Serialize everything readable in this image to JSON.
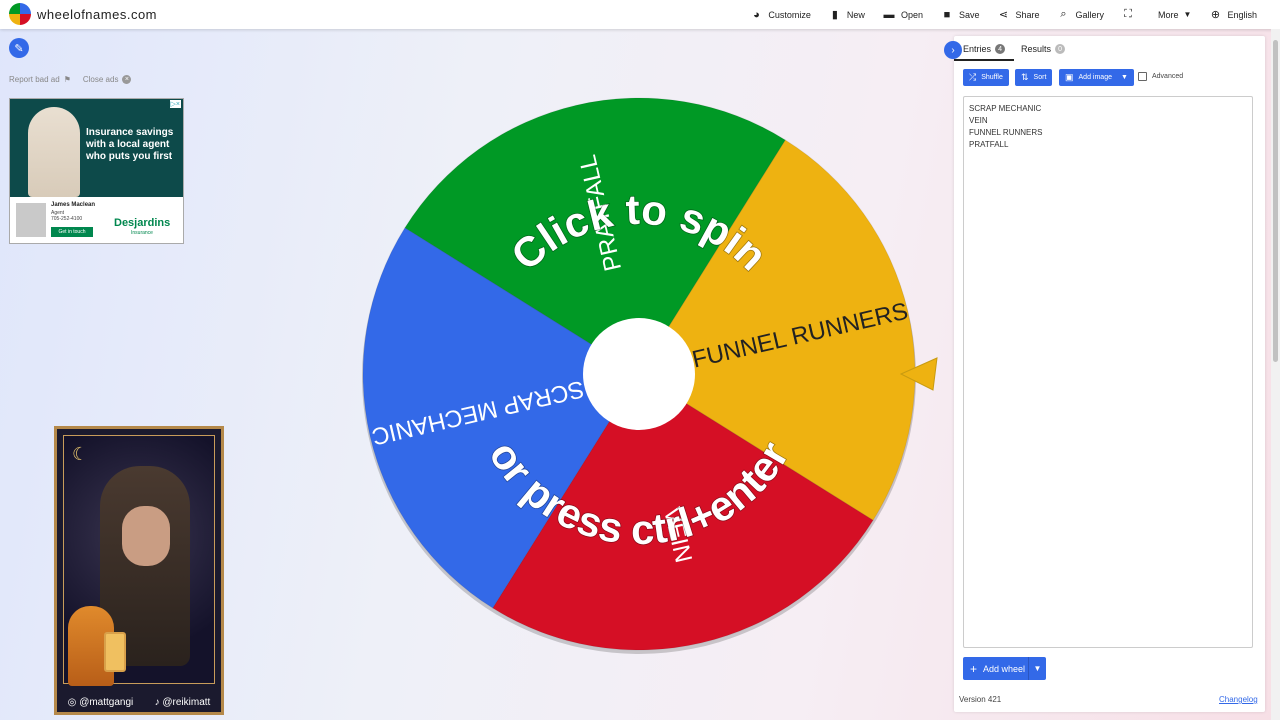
{
  "app": {
    "site_name": "wheelofnames.com",
    "accent": "#3369e8"
  },
  "nav": [
    {
      "label": "Customize",
      "icon": "palette-icon",
      "glyph": "◕"
    },
    {
      "label": "New",
      "icon": "new-file-icon",
      "glyph": "▮"
    },
    {
      "label": "Open",
      "icon": "folder-icon",
      "glyph": "▬"
    },
    {
      "label": "Save",
      "icon": "save-icon",
      "glyph": "■"
    },
    {
      "label": "Share",
      "icon": "share-icon",
      "glyph": "⋖"
    },
    {
      "label": "Gallery",
      "icon": "search-icon",
      "glyph": "⌕"
    },
    {
      "label": "",
      "icon": "fullscreen-icon",
      "glyph": "⛶"
    },
    {
      "label": "More",
      "icon": "",
      "glyph": ""
    },
    {
      "label": "English",
      "icon": "globe-icon",
      "glyph": "⊕"
    }
  ],
  "ads": {
    "report_label": "Report bad ad",
    "close_label": "Close ads",
    "headline": "Insurance savings with a local agent who puts you first",
    "agent_name": "James Maclean",
    "agent_role": "Agent",
    "agent_phone": "705-252-4100",
    "cta": "Get in touch",
    "brand": "Desjardins",
    "brand_sub": "Insurance"
  },
  "webcam": {
    "handle_left": "@mattgangi",
    "handle_right": "@reikimatt"
  },
  "wheel": {
    "center_text_top": "Click to spin",
    "center_text_bottom": "or press ctrl+enter",
    "segments": [
      {
        "label": "FUNNEL RUNNERS",
        "color": "#eeb211"
      },
      {
        "label": "VEIN",
        "color": "#d50f25"
      },
      {
        "label": "SCRAP MECHANIC",
        "color": "#3369e8"
      },
      {
        "label": "PRATFALL",
        "color": "#009925"
      }
    ],
    "pointer_color": "#eeb211"
  },
  "panel": {
    "tabs": [
      {
        "label": "Entries",
        "count": "4"
      },
      {
        "label": "Results",
        "count": "0"
      }
    ],
    "buttons": {
      "shuffle": "Shuffle",
      "sort": "Sort",
      "add_image": "Add image"
    },
    "advanced_label": "Advanced",
    "entries": [
      "SCRAP MECHANIC",
      "VEIN",
      "FUNNEL RUNNERS",
      "PRATFALL"
    ],
    "add_wheel_label": "Add wheel",
    "version": "Version 421",
    "changelog": "Changelog"
  }
}
